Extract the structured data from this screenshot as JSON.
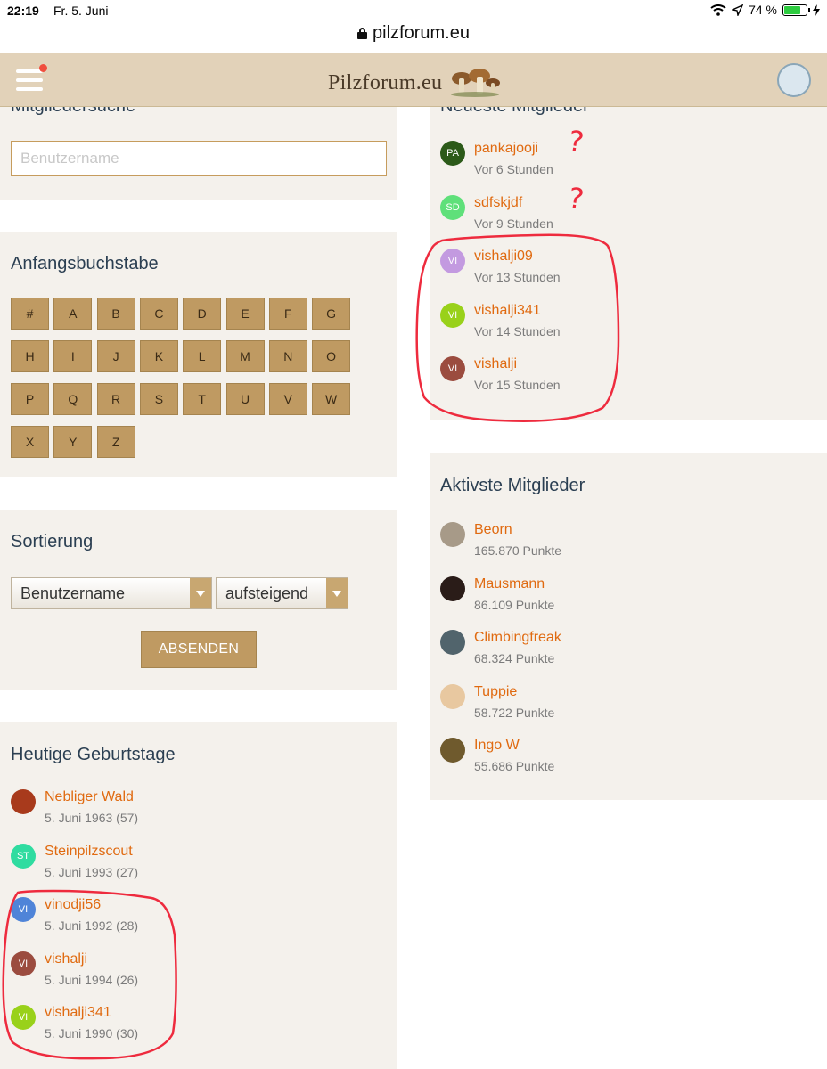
{
  "status_bar": {
    "time": "22:19",
    "date": "Fr. 5. Juni",
    "battery": "74 %"
  },
  "browser": {
    "url": "pilzforum.eu"
  },
  "header": {
    "logo_text": "Pilzforum.eu"
  },
  "search": {
    "title": "Mitgliedersuche",
    "placeholder": "Benutzername"
  },
  "letters": {
    "title": "Anfangsbuchstabe",
    "items": [
      "#",
      "A",
      "B",
      "C",
      "D",
      "E",
      "F",
      "G",
      "H",
      "I",
      "J",
      "K",
      "L",
      "M",
      "N",
      "O",
      "P",
      "Q",
      "R",
      "S",
      "T",
      "U",
      "V",
      "W",
      "X",
      "Y",
      "Z"
    ]
  },
  "sort": {
    "title": "Sortierung",
    "field_value": "Benutzername",
    "order_value": "aufsteigend",
    "submit_label": "ABSENDEN"
  },
  "birthdays": {
    "title": "Heutige Geburtstage",
    "members": [
      {
        "initials": "",
        "name": "Nebliger Wald",
        "sub": "5. Juni 1963 (57)",
        "color": "#a83a1c"
      },
      {
        "initials": "ST",
        "name": "Steinpilzscout",
        "sub": "5. Juni 1993 (27)",
        "color": "#2fdca0"
      },
      {
        "initials": "VI",
        "name": "vinodji56",
        "sub": "5. Juni 1992 (28)",
        "color": "#4f84d8"
      },
      {
        "initials": "VI",
        "name": "vishalji",
        "sub": "5. Juni 1994 (26)",
        "color": "#9b4c3f"
      },
      {
        "initials": "VI",
        "name": "vishalji341",
        "sub": "5. Juni 1990 (30)",
        "color": "#99d11a"
      }
    ]
  },
  "newest": {
    "title": "Neueste Mitglieder",
    "members": [
      {
        "initials": "PA",
        "name": "pankajooji",
        "sub": "Vor 6 Stunden",
        "color": "#2c5a19"
      },
      {
        "initials": "SD",
        "name": "sdfskjdf",
        "sub": "Vor 9 Stunden",
        "color": "#5fe07a"
      },
      {
        "initials": "VI",
        "name": "vishalji09",
        "sub": "Vor 13 Stunden",
        "color": "#c39ae0"
      },
      {
        "initials": "VI",
        "name": "vishalji341",
        "sub": "Vor 14 Stunden",
        "color": "#99d11a"
      },
      {
        "initials": "VI",
        "name": "vishalji",
        "sub": "Vor 15 Stunden",
        "color": "#9b4c3f"
      }
    ]
  },
  "active": {
    "title": "Aktivste Mitglieder",
    "members": [
      {
        "name": "Beorn",
        "sub": "165.870 Punkte",
        "color": "#a79a88"
      },
      {
        "name": "Mausmann",
        "sub": "86.109 Punkte",
        "color": "#2a1c18"
      },
      {
        "name": "Climbingfreak",
        "sub": "68.324 Punkte",
        "color": "#51646c"
      },
      {
        "name": "Tuppie",
        "sub": "58.722 Punkte",
        "color": "#e8c8a0"
      },
      {
        "name": "Ingo W",
        "sub": "55.686 Punkte",
        "color": "#6f5a2d"
      }
    ]
  },
  "annotations": {
    "question_mark": "?"
  }
}
